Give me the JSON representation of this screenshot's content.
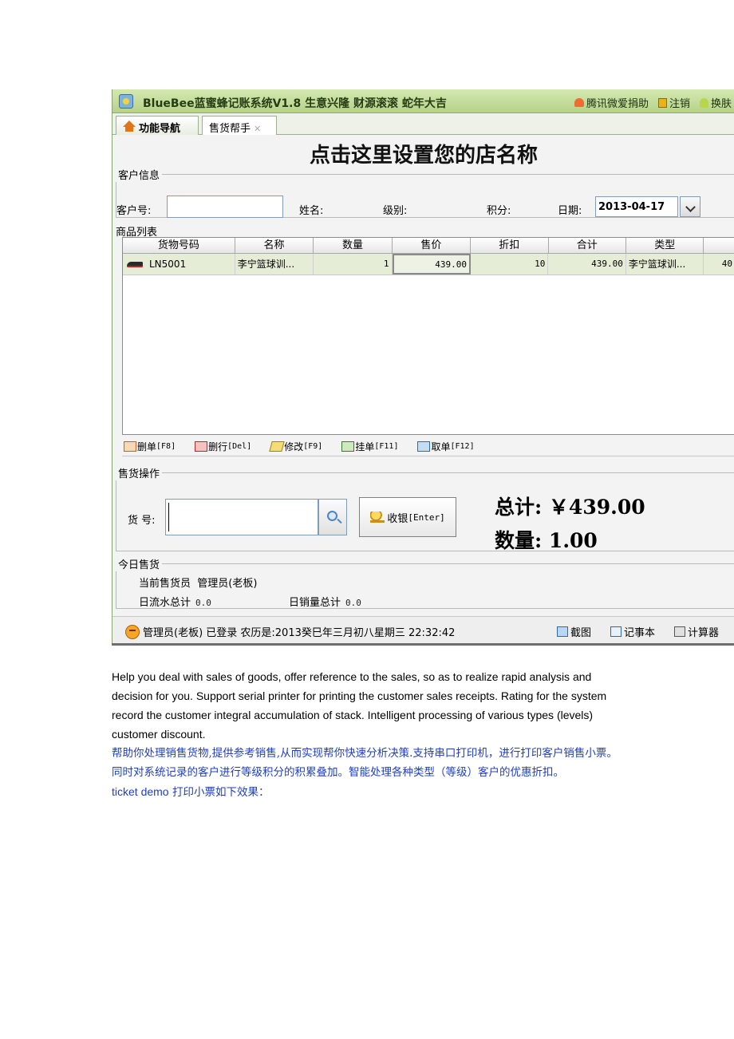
{
  "window": {
    "title": "BlueBee蓝蜜蜂记账系统V1.8 生意兴隆  财源滚滚  蛇年大吉",
    "links": [
      {
        "icon": "heart-icon",
        "label": "腾讯微爱捐助"
      },
      {
        "icon": "lock-icon",
        "label": "注销"
      },
      {
        "icon": "skin-icon",
        "label": "换肤"
      }
    ]
  },
  "tabs": {
    "nav_label": "功能导航",
    "sell_label": "售货帮手",
    "close_glyph": "✕"
  },
  "shop_name": "点击这里设置您的店名称",
  "customer": {
    "legend": "客户信息",
    "id_label": "客户号:",
    "id_value": "",
    "name_label": "姓名:",
    "level_label": "级别:",
    "points_label": "积分:",
    "date_label": "日期:",
    "date_value": "2013-04-17"
  },
  "goods": {
    "title": "商品列表",
    "columns": [
      "货物号码",
      "名称",
      "数量",
      "售价",
      "折扣",
      "合计",
      "类型",
      ""
    ],
    "rows": [
      {
        "code": "LN5001",
        "name": "李宁篮球训...",
        "qty": "1",
        "price": "439.00",
        "discount": "10",
        "total": "439.00",
        "type": "李宁篮球训...",
        "extra": "40"
      }
    ]
  },
  "actions": [
    {
      "label": "删单",
      "key": "[F8]",
      "icon": "delete-order-icon"
    },
    {
      "label": "删行",
      "key": "[Del]",
      "icon": "delete-row-icon"
    },
    {
      "label": "修改",
      "key": "[F9]",
      "icon": "edit-icon"
    },
    {
      "label": "挂单",
      "key": "[F11]",
      "icon": "hold-order-icon"
    },
    {
      "label": "取单",
      "key": "[F12]",
      "icon": "retrieve-order-icon"
    }
  ],
  "sale": {
    "legend": "售货操作",
    "goods_no_label": "货 号:",
    "goods_no_value": "",
    "cashier_label": "收银",
    "cashier_key": "[Enter]",
    "total_text": "总计: ￥439.00",
    "qty_text": "数量: 1.00"
  },
  "today": {
    "legend": "今日售货",
    "seller_label": "当前售货员",
    "seller_value": "管理员(老板)",
    "flow_label": "日流水总计",
    "flow_value": "0.0",
    "sales_label": "日销量总计",
    "sales_value": "0.0"
  },
  "status": {
    "text": "管理员(老板) 已登录  农历是:2013癸巳年三月初八星期三 22:32:42",
    "tools": [
      {
        "icon": "screenshot-icon",
        "label": "截图"
      },
      {
        "icon": "notepad-icon",
        "label": "记事本"
      },
      {
        "icon": "calculator-icon",
        "label": "计算器"
      }
    ]
  },
  "description": {
    "english": "Help you deal with sales of goods, offer reference to the sales, so as to realize rapid analysis and decision for you. Support serial printer for printing the customer sales receipts. Rating for the system record the customer integral accumulation of stack. Intelligent processing of various types (levels) customer discount.",
    "chinese": "帮助你处理销售货物,提供参考销售,从而实现帮你快速分析决策.支持串口打印机，进行打印客户销售小票。同时对系统记录的客户进行等级积分的积累叠加。智能处理各种类型（等级）客户的优惠折扣。",
    "demo_en": "ticket demo",
    "demo_cn": "打印小票如下效果："
  }
}
